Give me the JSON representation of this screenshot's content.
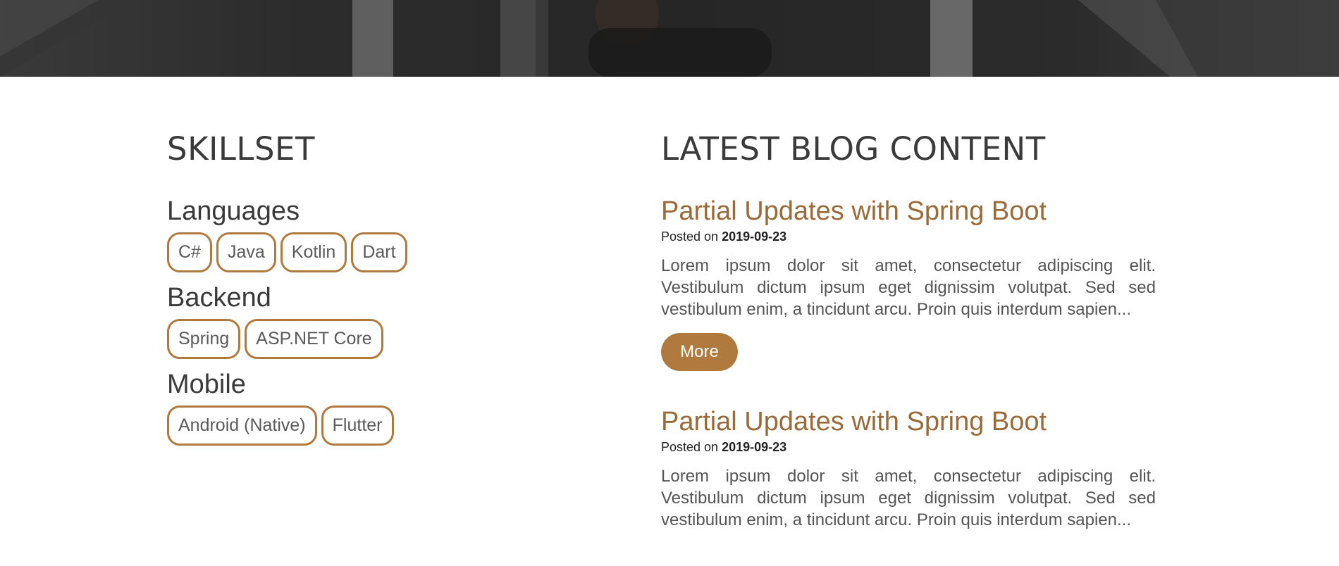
{
  "skillset": {
    "heading": "SKILLSET",
    "groups": [
      {
        "title": "Languages",
        "skills": [
          "C#",
          "Java",
          "Kotlin",
          "Dart"
        ]
      },
      {
        "title": "Backend",
        "skills": [
          "Spring",
          "ASP.NET Core"
        ]
      },
      {
        "title": "Mobile",
        "skills": [
          "Android (Native)",
          "Flutter"
        ]
      }
    ]
  },
  "blog": {
    "heading": "LATEST BLOG CONTENT",
    "posts": [
      {
        "title": "Partial Updates with Spring Boot",
        "posted_on_label": "Posted on",
        "date": "2019-09-23",
        "excerpt": "Lorem ipsum dolor sit amet, consectetur adipiscing elit. Vestibulum dictum ipsum eget dignissim volutpat. Sed sed vestibulum enim, a tincidunt arcu. Proin quis interdum sapien...",
        "more_label": "More"
      },
      {
        "title": "Partial Updates with Spring Boot",
        "posted_on_label": "Posted on",
        "date": "2019-09-23",
        "excerpt": "Lorem ipsum dolor sit amet, consectetur adipiscing elit. Vestibulum dictum ipsum eget dignissim volutpat. Sed sed vestibulum enim, a tincidunt arcu. Proin quis interdum sapien..."
      }
    ]
  },
  "colors": {
    "accent": "#b07a3e",
    "title_accent": "#9a6a38",
    "hero_dark": "#2a2a2a"
  }
}
